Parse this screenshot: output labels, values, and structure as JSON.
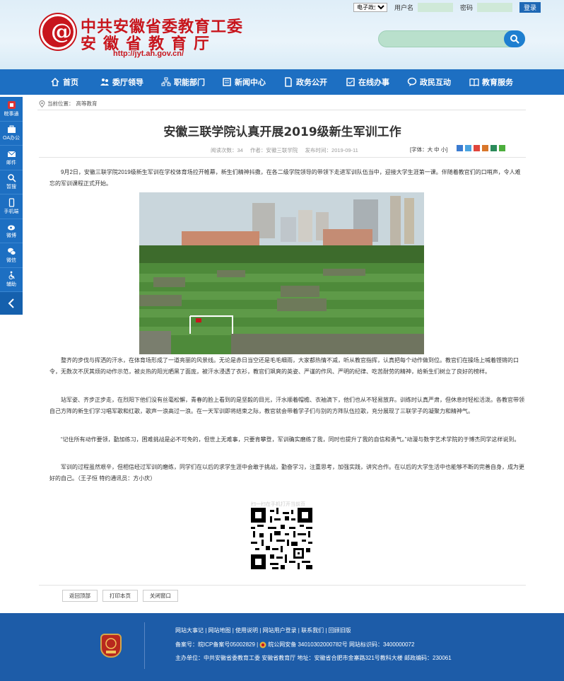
{
  "header": {
    "line1": "中共安徽省委教育工委",
    "line2": "安徽省教育厅",
    "url": "http://jyt.ah.gov.cn/",
    "login_select": "电子政务",
    "username_label": "用户名",
    "password_label": "密码",
    "login_button": "登录"
  },
  "nav": [
    "首页",
    "委厅领导",
    "职能部门",
    "新闻中心",
    "政务公开",
    "在线办事",
    "政民互动",
    "教育服务"
  ],
  "side": [
    "皖事通",
    "OA办公",
    "邮件",
    "暂搜",
    "手机端",
    "微博",
    "微信",
    "辅助"
  ],
  "breadcrumb": {
    "label": "当前位置：",
    "current": "高等教育"
  },
  "article": {
    "title": "安徽三联学院认真开展2019级新生军训工作",
    "views": "阅读次数：34",
    "author": "作者：安徽三联学院",
    "date": "发布时间：2019-09-11",
    "font_size": "[字体：大 中 小]",
    "paragraphs": [
      "9月2日，安徽三联学院2019级新生军训在学校体育场拉开帷幕，新生们精神抖擞，在各二级学院领导的带领下走进军训队伍当中，迎接大学生涯第一课。伴随着教官们的口哨声，令人难忘的军训课程正式开始。",
      "整齐的步伐与挥洒的汗水，在体育场形成了一道亮丽的风景线。无论是赤日当空还是毛毛细雨，大家都热情不减，听从教官指挥，认真把每个动作做到位。教官们在操场上喊着铿锵的口令，无数次不厌其烦的动作示范，被炎热的阳光晒黑了面庞，被汗水浸透了衣衫，教官们飒爽的英姿、严谨的作风、严明的纪律、吃苦耐劳的精神，给新生们树立了良好的榜样。",
      "站军姿、齐步正步走，在烈阳下他们没有丝毫松懈，青春的脸上看到的是坚毅的目光，汗水顺着帽檐、衣袖滴下，他们也从不轻易放弃。训练时认真严肃，但休息时轻松活泼。各教官带领自己方阵的新生们学习唱军歌和红歌，歌声一浪高过一浪。在一天军训即将结束之际，教官就会带着学子们与别的方阵队伍拉歌，充分展现了三联学子的凝聚力和精神气。",
      "“记住所有动作要领，勤加练习，困难挑战是必不可免的，但世上无难事，只要肯攀登，军训确实磨练了我，同时也提升了我的自信和勇气。”动漫与数字艺术学院的于博杰同学这样说到。",
      "军训的过程虽然艰辛，但相信经过军训的磨练，同学们在以后的求学生涯中会敢于挑战，勤奋学习，注重思考，加强实践，讲究合作。在以后的大学生活中也能够不断的完善自身，成为更好的自己。（王子恒 特约通讯员：方小庆）"
    ],
    "qr_caption": "扫一扫在手机打开当前页"
  },
  "tools": [
    "返回顶部",
    "打印本页",
    "关闭窗口"
  ],
  "footer": {
    "links": "网站大事记 | 网站地图 | 使用说明 | 网站用户登录 | 联系我们 | 回顾旧版",
    "icp": "备案号：皖ICP备案号05002829 |",
    "police": "皖公网安备 34010302000782号 网站标识码：3400000072",
    "host": "主办单位：中共安徽省委教育工委 安徽省教育厅 地址：安徽省合肥市金寨路321号教科大楼 邮政编码：230061"
  },
  "colors": {
    "brand_red": "#c8161d",
    "nav_blue": "#1d6fc2",
    "footer_blue": "#1d5ca8"
  }
}
